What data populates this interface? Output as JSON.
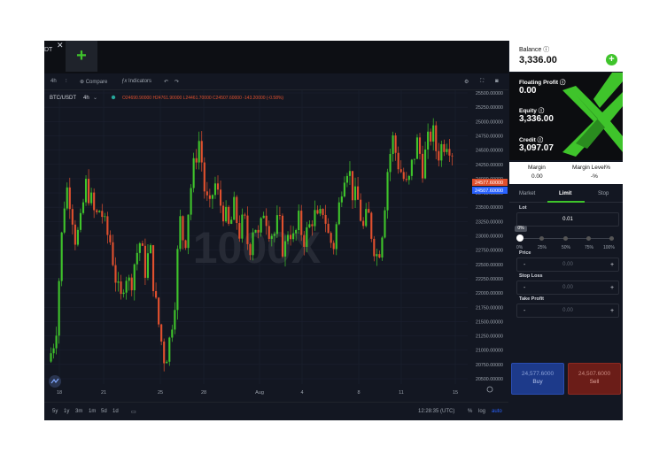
{
  "tab": {
    "label": "DT",
    "close_icon": "close-icon",
    "add_icon": "plus-icon"
  },
  "toolbar": {
    "interval": "4h",
    "compare_label": "Compare",
    "indicators_label": "Indicators"
  },
  "legend": {
    "symbol": "BTC/USDT",
    "interval": "4h",
    "ohlc": "O24690.90000 H24761.90000 L24461.70000 C24507.60000 -143.20000 (-0.58%)"
  },
  "watermark": "1000X",
  "price_axis": [
    "25500.00000",
    "25250.00000",
    "25000.00000",
    "24750.00000",
    "24500.00000",
    "24250.00000",
    "24000.00000",
    "23750.00000",
    "23500.00000",
    "23250.00000",
    "23000.00000",
    "22750.00000",
    "22500.00000",
    "22250.00000",
    "22000.00000",
    "21750.00000",
    "21500.00000",
    "21250.00000",
    "21000.00000",
    "20750.00000",
    "20500.00000"
  ],
  "price_tags": {
    "ask": "24577.60000",
    "bid": "24507.60000"
  },
  "time_axis": [
    "18",
    "21",
    "25",
    "28",
    "Aug",
    "4",
    "8",
    "11",
    "15"
  ],
  "timeframes": [
    "5y",
    "1y",
    "3m",
    "1m",
    "5d",
    "1d"
  ],
  "clock": "12:28:35 (UTC)",
  "axis_options": {
    "percent": "%",
    "log": "log",
    "auto": "auto"
  },
  "account": {
    "balance_label": "Balance",
    "balance_value": "3,336.00",
    "floating_label": "Floating Profit",
    "floating_value": "0.00",
    "equity_label": "Equity",
    "equity_value": "3,336.00",
    "credit_label": "Credit",
    "credit_value": "3,097.07",
    "margin_label": "Margin",
    "margin_value": "0.00",
    "margin_level_label": "Margin Level%",
    "margin_level_value": "-%"
  },
  "order_tabs": [
    "Market",
    "Limit",
    "Stop"
  ],
  "order": {
    "lot_label": "Lot",
    "lot_value": "0.01",
    "slider_badge": "0%",
    "slider_ticks": [
      "0%",
      "25%",
      "50%",
      "75%",
      "100%"
    ],
    "price_label": "Price",
    "price_value": "0.00",
    "stop_loss_label": "Stop Loss",
    "stop_loss_value": "0.00",
    "take_profit_label": "Take Profit",
    "take_profit_value": "0.00",
    "minus": "-",
    "plus": "+"
  },
  "buy": {
    "price": "24,577.6000",
    "label": "Buy"
  },
  "sell": {
    "price": "24,507.6000",
    "label": "Sell"
  },
  "colors": {
    "up": "#3fc42b",
    "down": "#e0502e",
    "accent": "#3fc42b",
    "buy": "#1d3a8a",
    "sell": "#6b1d18"
  },
  "chart_data": {
    "type": "candlestick",
    "symbol": "BTC/USDT",
    "interval": "4h",
    "ylim": [
      20400,
      25600
    ],
    "x_ticks": [
      "18",
      "21",
      "25",
      "28",
      "Aug",
      "4",
      "8",
      "11",
      "15"
    ],
    "last_ask": 24577.6,
    "last_bid": 24507.6,
    "close_path": [
      20950,
      21300,
      22800,
      23900,
      23600,
      22900,
      23200,
      23900,
      23650,
      23300,
      23500,
      23100,
      22900,
      22300,
      21800,
      22400,
      22100,
      22600,
      22900,
      22400,
      22800,
      21900,
      21300,
      20800,
      21200,
      21900,
      23300,
      22800,
      23700,
      24300,
      24700,
      23800,
      23400,
      23950,
      23600,
      23400,
      23100,
      23500,
      23050,
      23300,
      22700,
      23300,
      22900,
      23500,
      23150,
      23000,
      23300,
      22650,
      23200,
      22900,
      23250,
      22950,
      23100,
      23400,
      23200,
      23500,
      23000,
      22800,
      23400,
      24100,
      24250,
      23700,
      23600,
      23100,
      23400,
      22900,
      22600,
      23200,
      24200,
      24700,
      24300,
      24050,
      23800,
      24300,
      24650,
      24200,
      24600,
      24850,
      24400,
      24600,
      24700,
      24508
    ]
  }
}
